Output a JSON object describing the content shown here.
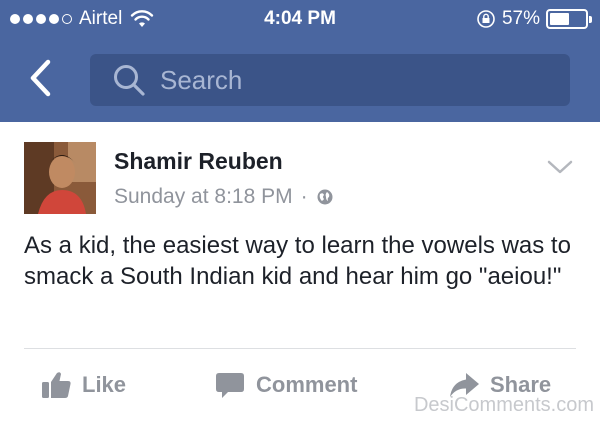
{
  "status_bar": {
    "carrier": "Airtel",
    "time": "4:04 PM",
    "battery": "57%",
    "battery_level": 0.57,
    "signal_bars_filled": 4,
    "signal_bars_total": 5
  },
  "nav": {
    "search_placeholder": "Search"
  },
  "post": {
    "author": "Shamir Reuben",
    "timestamp": "Sunday at 8:18 PM",
    "separator": "·",
    "text": "As a kid, the easiest way to learn the vowels was to smack a South Indian kid and hear him go \"aeiou!\"",
    "actions": {
      "like": "Like",
      "comment": "Comment",
      "share": "Share"
    }
  },
  "watermark": "DesiComments.com",
  "colors": {
    "header": "#4a66a0",
    "search_box": "#3b5488",
    "muted_text": "#90949c",
    "body_text": "#1d2129"
  }
}
